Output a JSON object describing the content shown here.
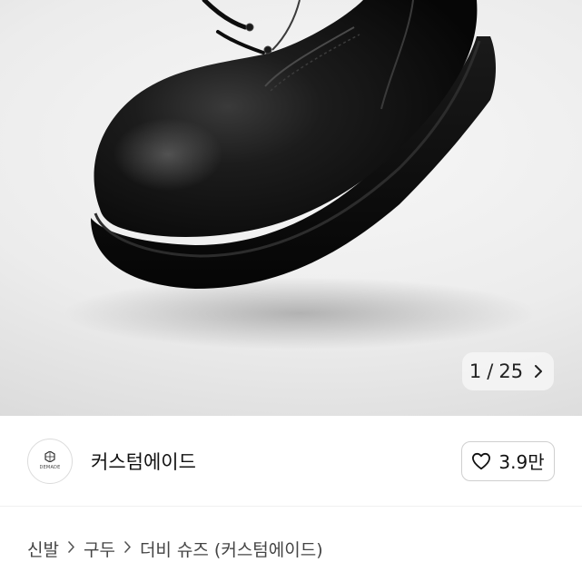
{
  "gallery": {
    "current_index": "1",
    "separator": "/",
    "total": "25",
    "next_icon": "chevron-right-icon"
  },
  "seller": {
    "avatar_text": "DEMADE",
    "name": "커스텀에이드",
    "like_icon": "heart-outline-icon",
    "like_count": "3.9만"
  },
  "breadcrumb": {
    "items": [
      "신발",
      "구두",
      "더비 슈즈 (커스텀에이드)"
    ],
    "separator_icon": "chevron-right-icon"
  },
  "colors": {
    "background": "#ffffff",
    "text": "#111111",
    "border": "#cfcfcf"
  }
}
